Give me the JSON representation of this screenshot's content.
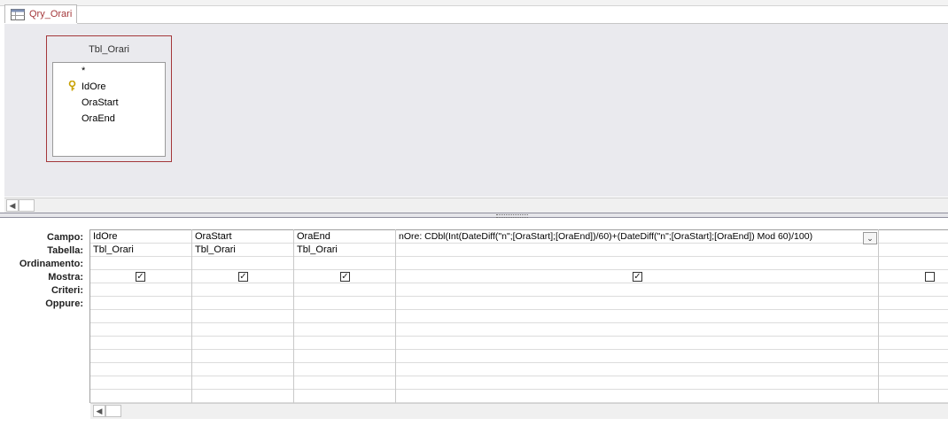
{
  "tab": {
    "title": "Qry_Orari",
    "icon": "query-icon"
  },
  "table": {
    "name": "Tbl_Orari",
    "fields": [
      {
        "name": "*",
        "key": false
      },
      {
        "name": "IdOre",
        "key": true
      },
      {
        "name": "OraStart",
        "key": false
      },
      {
        "name": "OraEnd",
        "key": false
      }
    ]
  },
  "grid": {
    "row_labels": {
      "campo": "Campo:",
      "tabella": "Tabella:",
      "ordinamento": "Ordinamento:",
      "mostra": "Mostra:",
      "criteri": "Criteri:",
      "oppure": "Oppure:"
    },
    "columns": [
      {
        "campo": "IdOre",
        "tabella": "Tbl_Orari",
        "mostra": true
      },
      {
        "campo": "OraStart",
        "tabella": "Tbl_Orari",
        "mostra": true
      },
      {
        "campo": "OraEnd",
        "tabella": "Tbl_Orari",
        "mostra": true
      },
      {
        "campo": "nOre: CDbl(Int(DateDiff(\"n\";[OraStart];[OraEnd])/60)+(DateDiff(\"n\";[OraStart];[OraEnd]) Mod 60)/100)",
        "tabella": "",
        "mostra": true
      },
      {
        "campo": "",
        "tabella": "",
        "mostra": false
      }
    ]
  },
  "colors": {
    "accent": "#a4373a",
    "design_bg": "#eaeaee"
  }
}
